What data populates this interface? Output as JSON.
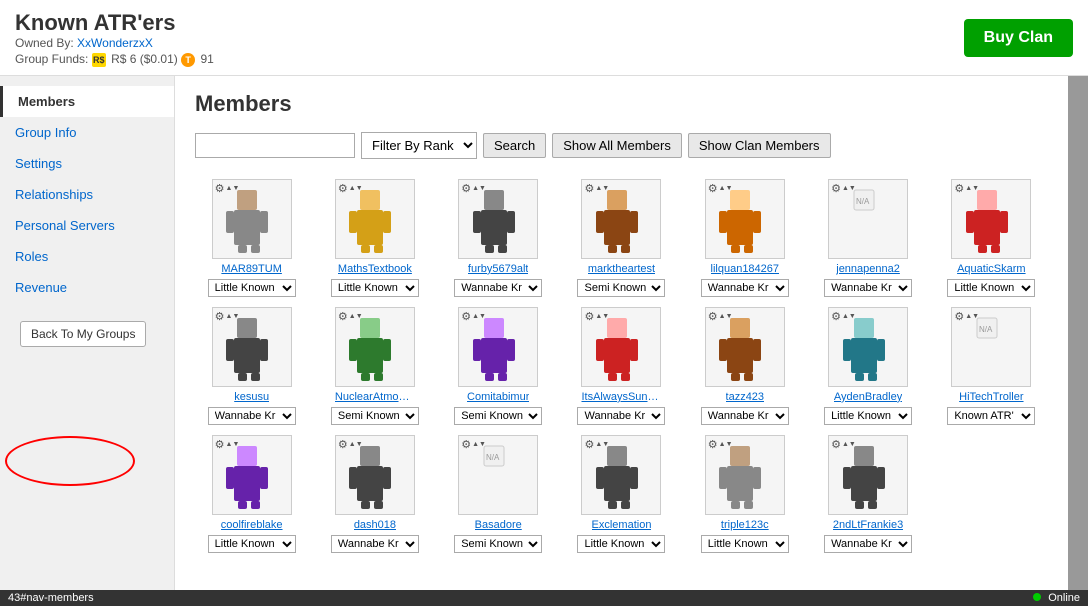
{
  "header": {
    "title": "Known ATR'ers",
    "owned_by_label": "Owned By:",
    "owner_name": "XxWonderzxX",
    "funds_label": "Group Funds:",
    "funds_amount": "R$ 6 ($0.01)",
    "tickets": "91",
    "buy_clan_label": "Buy Clan"
  },
  "sidebar": {
    "items": [
      {
        "label": "Members",
        "active": true
      },
      {
        "label": "Group Info",
        "active": false
      },
      {
        "label": "Settings",
        "active": false
      },
      {
        "label": "Relationships",
        "active": false
      },
      {
        "label": "Personal Servers",
        "active": false
      },
      {
        "label": "Roles",
        "active": false
      },
      {
        "label": "Revenue",
        "active": false
      }
    ],
    "back_btn_label": "Back To My Groups"
  },
  "content": {
    "section_title": "Members",
    "search": {
      "placeholder": "",
      "filter_label": "Filter By Rank",
      "search_btn": "Search",
      "show_all_btn": "Show All Members",
      "show_clan_btn": "Show Clan Members"
    },
    "members": [
      {
        "name": "MAR89TUM",
        "rank": "Little Known",
        "avatar_color": "gray"
      },
      {
        "name": "MathsTextbook",
        "rank": "Little Known",
        "avatar_color": "gold"
      },
      {
        "name": "furby5679alt",
        "rank": "Wannabe Kr",
        "avatar_color": "dark"
      },
      {
        "name": "marktheartest",
        "rank": "Semi Known",
        "avatar_color": "brown"
      },
      {
        "name": "lilquan184267",
        "rank": "Wannabe Kr",
        "avatar_color": "orange"
      },
      {
        "name": "jennapenna2",
        "rank": "Wannabe Kr",
        "avatar_color": "white"
      },
      {
        "name": "AquaticSkarm",
        "rank": "Little Known",
        "avatar_color": "red"
      },
      {
        "name": "kesusu",
        "rank": "Wannabe Kr",
        "avatar_color": "dark"
      },
      {
        "name": "NuclearAtmosph",
        "rank": "Semi Known",
        "avatar_color": "green"
      },
      {
        "name": "Comitabimur",
        "rank": "Semi Known",
        "avatar_color": "purple"
      },
      {
        "name": "ItsAlwaysSunnyIr",
        "rank": "Wannabe Kr",
        "avatar_color": "red"
      },
      {
        "name": "tazz423",
        "rank": "Wannabe Kr",
        "avatar_color": "brown"
      },
      {
        "name": "AydenBradley",
        "rank": "Little Known",
        "avatar_color": "teal"
      },
      {
        "name": "HiTechTroller",
        "rank": "Known ATR'",
        "avatar_color": "gray"
      },
      {
        "name": "coolfireblake",
        "rank": "Little Known",
        "avatar_color": "purple"
      },
      {
        "name": "dash018",
        "rank": "Wannabe Kr",
        "avatar_color": "dark"
      },
      {
        "name": "Basadore",
        "rank": "Semi Known",
        "avatar_color": "white"
      },
      {
        "name": "Exclemation",
        "rank": "Little Known",
        "avatar_color": "dark"
      },
      {
        "name": "triple123c",
        "rank": "Little Known",
        "avatar_color": "gray"
      },
      {
        "name": "2ndLtFrankie3",
        "rank": "Wannabe Kr",
        "avatar_color": "dark"
      }
    ],
    "rank_options": [
      "Little Known",
      "Wannabe Kr",
      "Semi Known",
      "Known ATR'"
    ]
  },
  "statusbar": {
    "url": "43#nav-members",
    "online_label": "Online"
  }
}
